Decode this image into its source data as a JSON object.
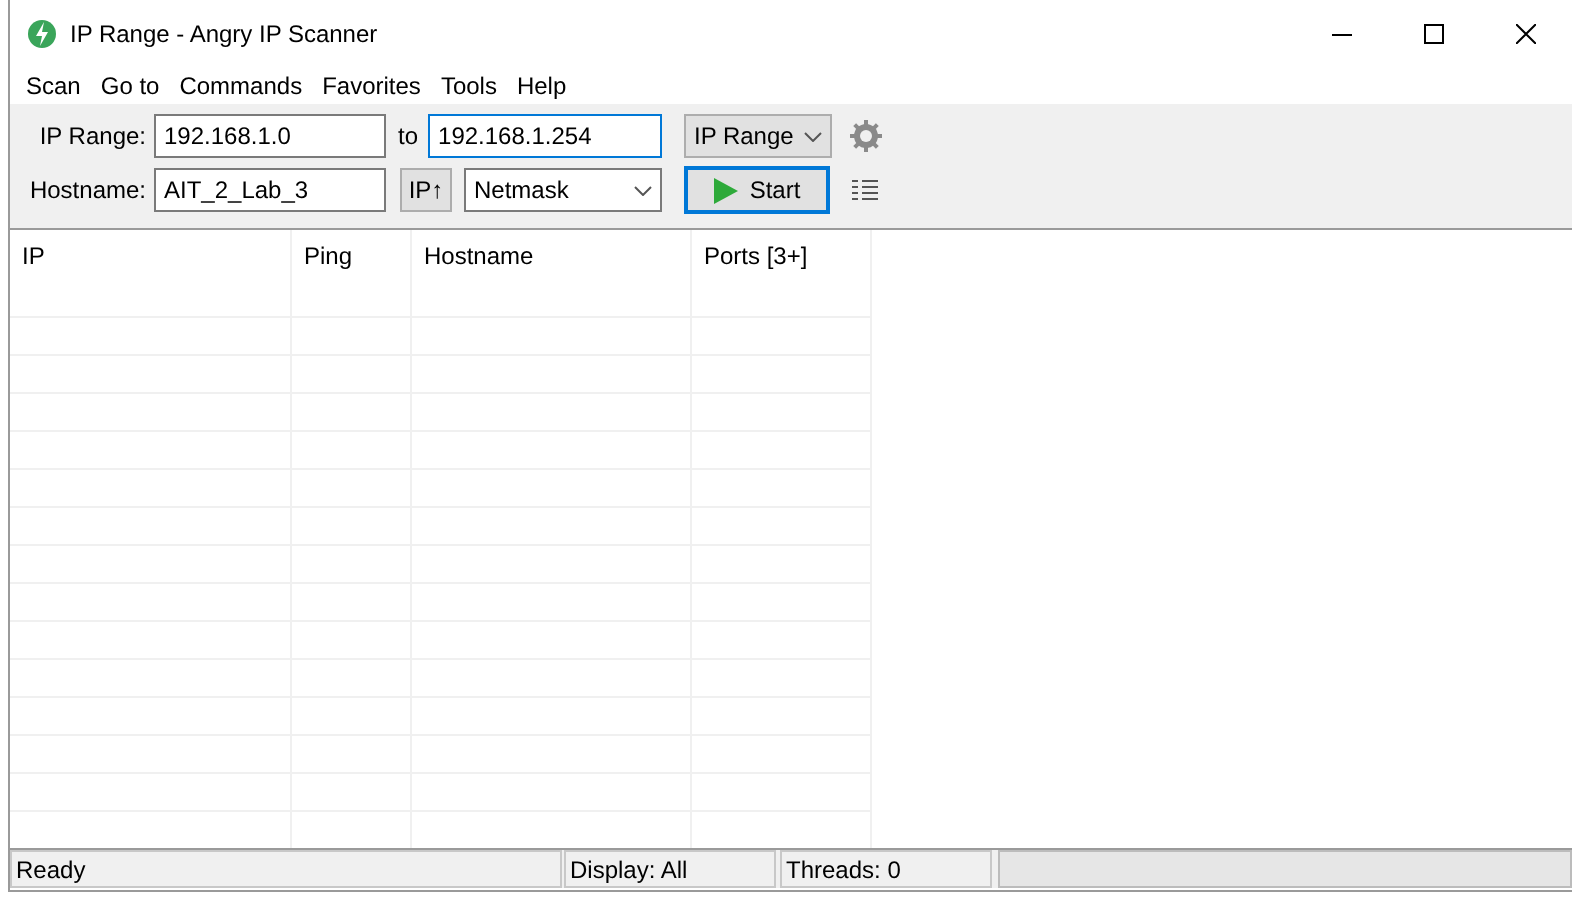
{
  "window": {
    "title": "IP Range - Angry IP Scanner"
  },
  "menu": [
    "Scan",
    "Go to",
    "Commands",
    "Favorites",
    "Tools",
    "Help"
  ],
  "toolbar": {
    "range_label": "IP Range:",
    "start_ip": "192.168.1.0",
    "to_label": "to",
    "end_ip": "192.168.1.254",
    "feeder": "IP Range",
    "hostname_label": "Hostname:",
    "hostname": "AIT_2_Lab_3",
    "ip_button": "IP↑",
    "netmask": "Netmask",
    "start_button": "Start"
  },
  "table": {
    "columns": [
      "IP",
      "Ping",
      "Hostname",
      "Ports [3+]"
    ]
  },
  "status_bar": {
    "status": "Ready",
    "display": "Display: All",
    "threads": "Threads: 0",
    "progress": {
      "level": 0
    }
  }
}
